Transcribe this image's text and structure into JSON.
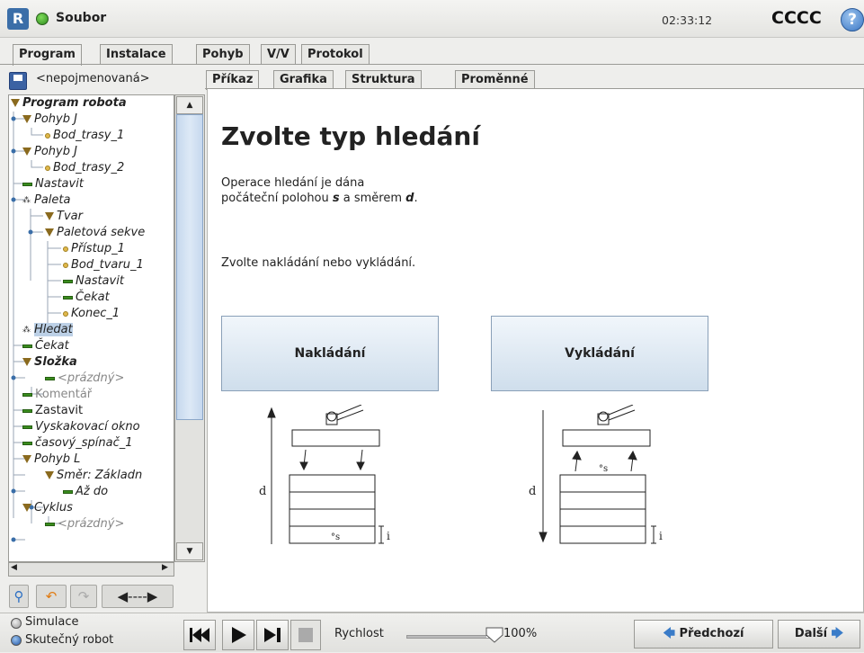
{
  "app": {
    "title": "Soubor",
    "clock": "02:33:12",
    "robot_name": "CCCC",
    "help_symbol": "?",
    "logo_text": "R"
  },
  "main_tabs": [
    {
      "label": "Program",
      "active": true
    },
    {
      "label": "Instalace"
    },
    {
      "label": "Pohyb"
    },
    {
      "label": "V/V"
    },
    {
      "label": "Protokol"
    }
  ],
  "program_name": "<nepojmenovaná>",
  "sub_tabs": [
    {
      "label": "Příkaz",
      "active": true
    },
    {
      "label": "Grafika"
    },
    {
      "label": "Struktura"
    },
    {
      "label": "Proměnné"
    }
  ],
  "tree": [
    {
      "label": "Program robota",
      "marker": "triangle",
      "bold": true
    },
    {
      "label": "Pohyb J",
      "marker": "triangle"
    },
    {
      "label": "Bod_trasy_1",
      "marker": "dot"
    },
    {
      "label": "Pohyb J",
      "marker": "triangle"
    },
    {
      "label": "Bod_trasy_2",
      "marker": "dot"
    },
    {
      "label": "Nastavit",
      "marker": "bar"
    },
    {
      "label": "Paleta",
      "marker": "pallet"
    },
    {
      "label": "Tvar",
      "marker": "triangle"
    },
    {
      "label": "Paletová sekve",
      "marker": "triangle"
    },
    {
      "label": "Přístup_1",
      "marker": "dot"
    },
    {
      "label": "Bod_tvaru_1",
      "marker": "dot"
    },
    {
      "label": "Nastavit",
      "marker": "bar"
    },
    {
      "label": "Čekat",
      "marker": "bar"
    },
    {
      "label": "Konec_1",
      "marker": "dot"
    },
    {
      "label": "Hledat",
      "marker": "pallet",
      "selected": true
    },
    {
      "label": "Čekat",
      "marker": "bar"
    },
    {
      "label": "Složka",
      "marker": "triangle",
      "bold": true
    },
    {
      "label": "<prázdný>",
      "marker": "bar",
      "grey": true
    },
    {
      "label": "Komentář",
      "marker": "bar",
      "grey": true,
      "normal": true
    },
    {
      "label": "Zastavit",
      "marker": "bar",
      "normal": true
    },
    {
      "label": "Vyskakovací okno",
      "marker": "bar"
    },
    {
      "label": "časový_spínač_1",
      "marker": "bar"
    },
    {
      "label": "Pohyb L",
      "marker": "triangle"
    },
    {
      "label": "Směr: Základn",
      "marker": "triangle"
    },
    {
      "label": "Až do",
      "marker": "bar"
    },
    {
      "label": "Cyklus",
      "marker": "triangle"
    },
    {
      "label": "<prázdný>",
      "marker": "bar",
      "grey": true
    }
  ],
  "content": {
    "heading": "Zvolte typ hledání",
    "desc_line1": "Operace hledání je dána",
    "desc_line2_pre": "počáteční polohou ",
    "desc_s": "s",
    "desc_mid": " a směrem ",
    "desc_d": "d",
    "desc_end": ".",
    "prompt": "Zvolte nakládání nebo vykládání.",
    "stack_button": "Nakládání",
    "destack_button": "Vykládání",
    "diagram": {
      "d_label": "d",
      "s_label": "°s",
      "i_label": "i"
    }
  },
  "bottom": {
    "simulation": "Simulace",
    "real_robot": "Skutečný robot",
    "speed_label": "Rychlost",
    "speed_value": "100%",
    "speed_fraction": 1.0,
    "prev_button": "Předchozí",
    "next_button": "Další"
  }
}
